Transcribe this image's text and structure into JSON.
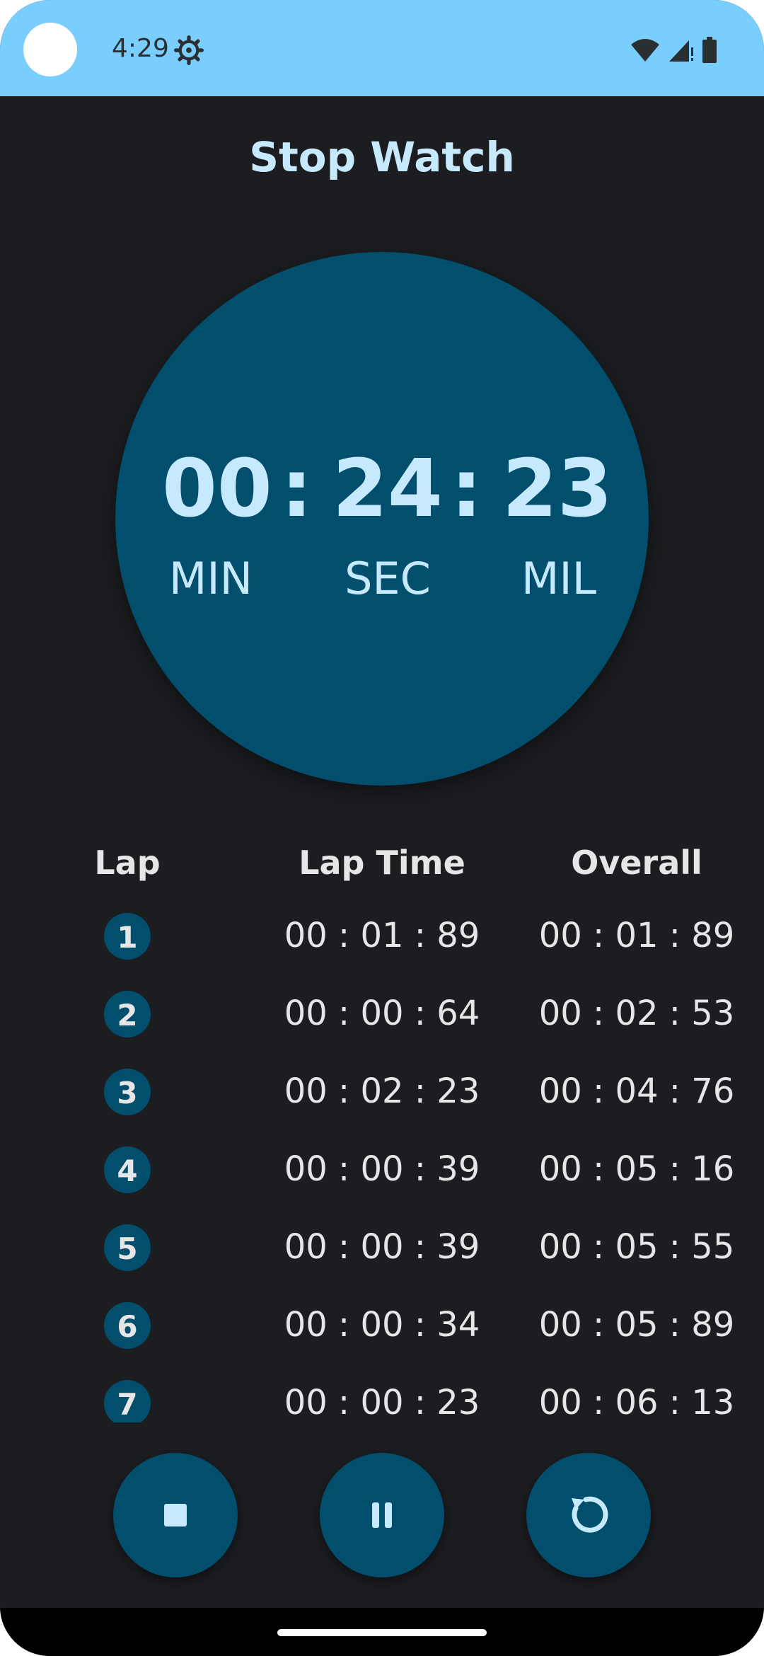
{
  "status_bar": {
    "time": "4:29",
    "icons": [
      "settings-gear-icon",
      "wifi-icon",
      "cell-signal-icon",
      "battery-icon"
    ],
    "background": "#7acefd"
  },
  "app": {
    "title": "Stop Watch"
  },
  "clock": {
    "minutes": "00",
    "separator1": ":",
    "seconds": "24",
    "separator2": ":",
    "millis": "23",
    "unit_min": "MIN",
    "unit_sec": "SEC",
    "unit_mil": "MIL",
    "face_color": "#024e6d"
  },
  "laps": {
    "header_lap": "Lap",
    "header_lap_time": "Lap Time",
    "header_overall": "Overall",
    "rows": [
      {
        "num": "1",
        "lap_time": "00 : 01 : 89",
        "overall": "00 : 01 : 89"
      },
      {
        "num": "2",
        "lap_time": "00 : 00 : 64",
        "overall": "00 : 02 : 53"
      },
      {
        "num": "3",
        "lap_time": "00 : 02 : 23",
        "overall": "00 : 04 : 76"
      },
      {
        "num": "4",
        "lap_time": "00 : 00 : 39",
        "overall": "00 : 05 : 16"
      },
      {
        "num": "5",
        "lap_time": "00 : 00 : 39",
        "overall": "00 : 05 : 55"
      },
      {
        "num": "6",
        "lap_time": "00 : 00 : 34",
        "overall": "00 : 05 : 89"
      },
      {
        "num": "7",
        "lap_time": "00 : 00 : 23",
        "overall": "00 : 06 : 13"
      }
    ]
  },
  "controls": {
    "stop_icon": "stop-icon",
    "pause_icon": "pause-icon",
    "reset_icon": "reset-icon"
  },
  "colors": {
    "background": "#1b1d20",
    "accent_dark": "#024e6d",
    "accent_light": "#c7e9fd",
    "text": "#e6e6e6"
  }
}
